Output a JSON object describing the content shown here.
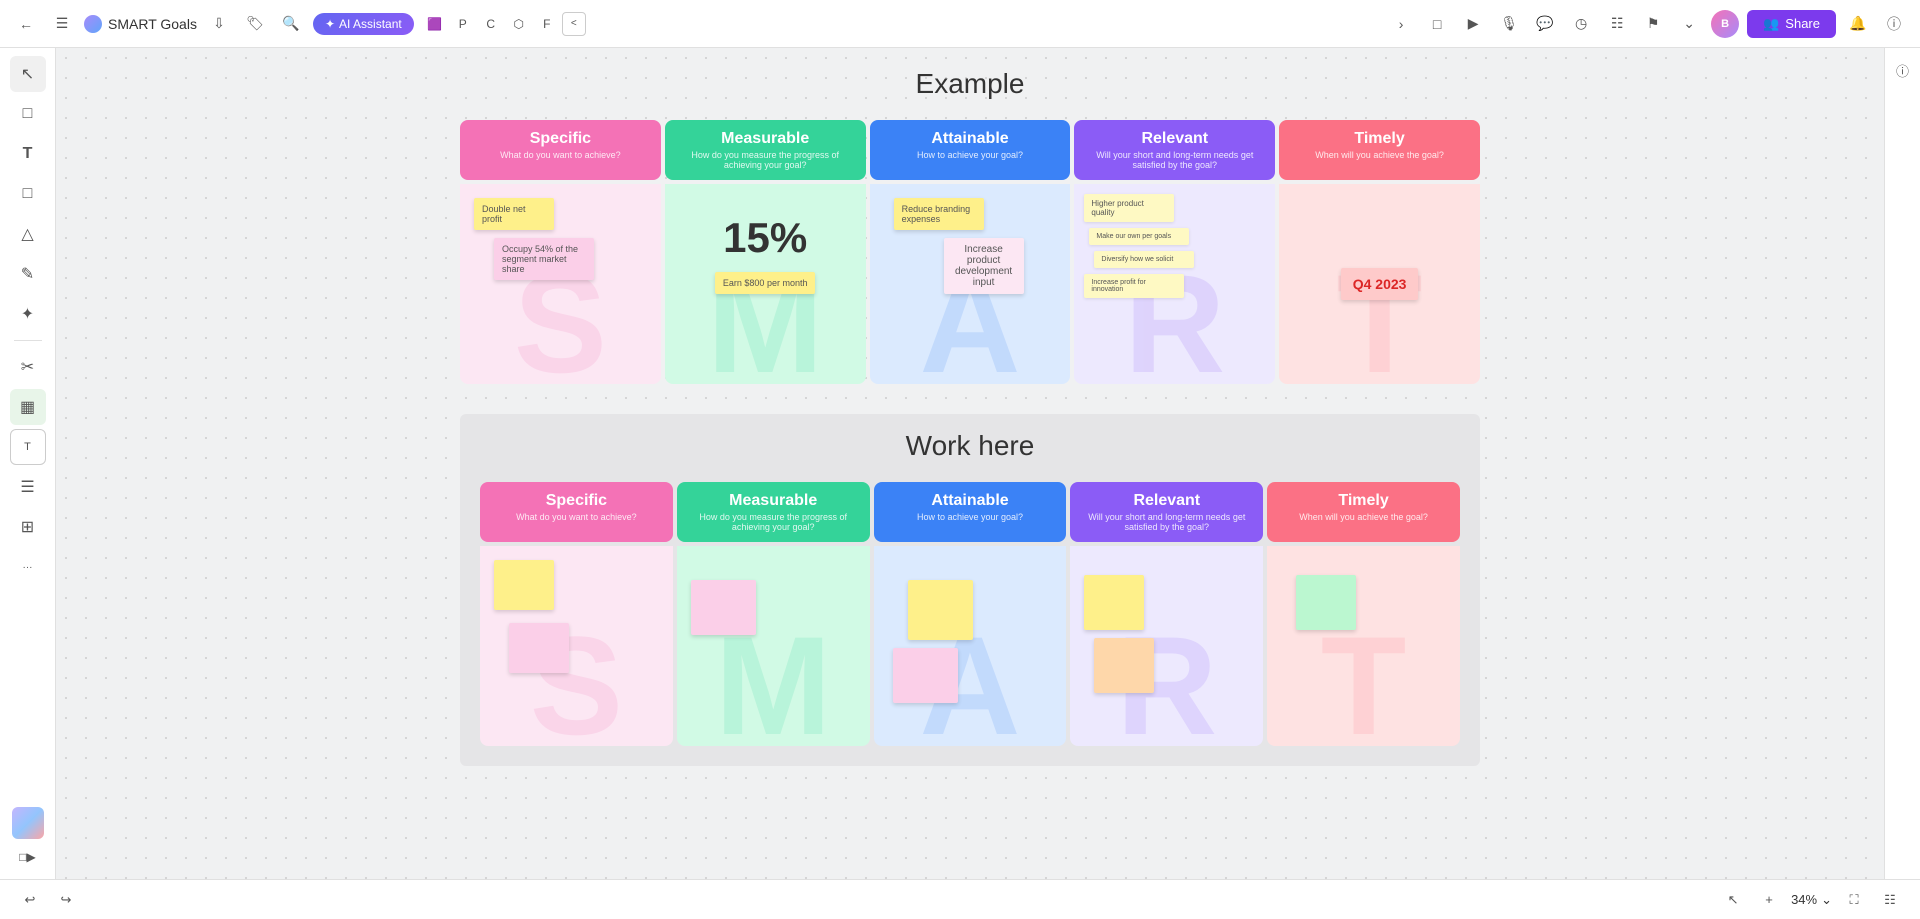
{
  "app": {
    "title": "SMART Goals",
    "ai_assistant_label": "AI Assistant",
    "share_label": "Share"
  },
  "sections": [
    {
      "id": "example",
      "title": "Example",
      "columns": [
        {
          "id": "specific",
          "letter": "S",
          "header": "Specific",
          "subtitle": "What do you want to achieve?",
          "notes": [
            {
              "text": "Double net profit",
              "color": "yellow"
            },
            {
              "text": "Occupy 54% of the segment market share",
              "color": "pink"
            }
          ]
        },
        {
          "id": "measurable",
          "letter": "M",
          "header": "Measurable",
          "subtitle": "How do you measure the progress of achieving your goal?",
          "notes": [
            {
              "text": "Earn $800 per month",
              "color": "yellow"
            },
            {
              "text": "15%",
              "is_big": true
            }
          ]
        },
        {
          "id": "attainable",
          "letter": "A",
          "header": "Attainable",
          "subtitle": "How to achieve your goal?",
          "notes": [
            {
              "text": "Reduce branding expenses",
              "color": "yellow"
            },
            {
              "text": "Increase product development input",
              "color": "pink"
            }
          ]
        },
        {
          "id": "relevant",
          "letter": "R",
          "header": "Relevant",
          "subtitle": "Will your short and long-term needs get satisfied by the goal?",
          "notes": [
            {
              "text": "Higher product quality",
              "color": "yellow"
            },
            {
              "text": "Make our own per goals",
              "color": "yellow"
            },
            {
              "text": "Diversify how we solicit",
              "color": "yellow"
            },
            {
              "text": "Increase profit for innovation",
              "color": "yellow"
            }
          ]
        },
        {
          "id": "timely",
          "letter": "T",
          "header": "Timely",
          "subtitle": "When will you achieve the goal?",
          "notes": [
            {
              "text": "Q4 2023",
              "color": "pink",
              "is_q4": true
            }
          ]
        }
      ]
    },
    {
      "id": "work-here",
      "title": "Work here",
      "columns": [
        {
          "id": "specific",
          "letter": "S",
          "header": "Specific",
          "subtitle": "What do you want to achieve?",
          "notes": [
            {
              "text": "",
              "color": "yellow"
            },
            {
              "text": "",
              "color": "pink"
            }
          ]
        },
        {
          "id": "measurable",
          "letter": "M",
          "header": "Measurable",
          "subtitle": "How do you measure the progress of achieving your goal?",
          "notes": [
            {
              "text": "",
              "color": "pink"
            }
          ]
        },
        {
          "id": "attainable",
          "letter": "A",
          "header": "Attainable",
          "subtitle": "How to achieve your goal?",
          "notes": [
            {
              "text": "",
              "color": "yellow"
            },
            {
              "text": "",
              "color": "pink"
            }
          ]
        },
        {
          "id": "relevant",
          "letter": "R",
          "header": "Relevant",
          "subtitle": "Will your short and long-term needs get satisfied by the goal?",
          "notes": [
            {
              "text": "",
              "color": "yellow"
            },
            {
              "text": "",
              "color": "peach"
            }
          ]
        },
        {
          "id": "timely",
          "letter": "T",
          "header": "Timely",
          "subtitle": "When will you achieve the goal?",
          "notes": [
            {
              "text": "",
              "color": "green"
            }
          ]
        }
      ]
    }
  ],
  "bottombar": {
    "zoom_label": "34%"
  },
  "sidebar": {
    "icons": [
      {
        "name": "cursor-icon",
        "symbol": "↖"
      },
      {
        "name": "frame-icon",
        "symbol": "▢"
      },
      {
        "name": "text-icon",
        "symbol": "T"
      },
      {
        "name": "sticky-icon",
        "symbol": "◻"
      },
      {
        "name": "shape-icon",
        "symbol": "⬡"
      },
      {
        "name": "pen-icon",
        "symbol": "✏"
      },
      {
        "name": "highlight-icon",
        "symbol": "✦"
      },
      {
        "name": "scissors-icon",
        "symbol": "✂"
      },
      {
        "name": "table-icon",
        "symbol": "▦"
      },
      {
        "name": "text2-icon",
        "symbol": "T"
      },
      {
        "name": "list-icon",
        "symbol": "☰"
      },
      {
        "name": "grid-icon",
        "symbol": "⊞"
      },
      {
        "name": "more-icon",
        "symbol": "···"
      }
    ]
  }
}
